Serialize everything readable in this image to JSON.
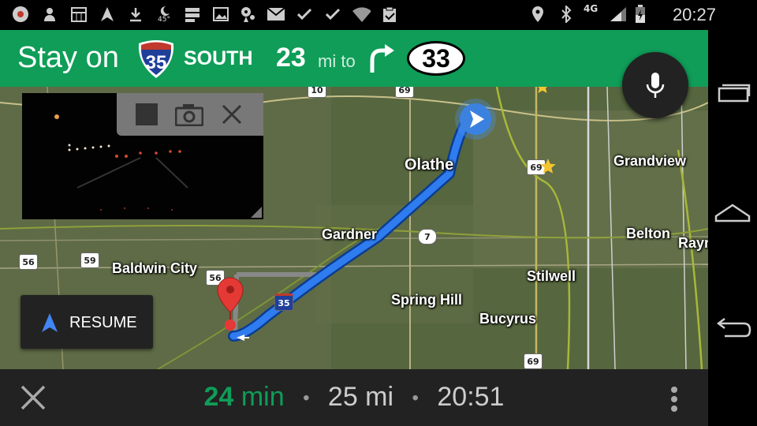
{
  "status_bar": {
    "time": "20:27",
    "network": "4G",
    "weather_temp": "45°"
  },
  "banner": {
    "instruction": "Stay on",
    "highway_number": "35",
    "direction": "SOUTH",
    "distance": "23",
    "distance_unit": "mi to",
    "exit_number": "33",
    "color": "#0f9d58"
  },
  "map": {
    "places": [
      "Olathe",
      "Grandview",
      "Gardner",
      "Belton",
      "Rayr",
      "Baldwin City",
      "Stilwell",
      "Spring Hill",
      "Bucyrus"
    ],
    "route_shields": [
      "10",
      "69",
      "7",
      "56",
      "59",
      "56",
      "35",
      "69"
    ],
    "route_color": "#1a73e8"
  },
  "camera_controls": {
    "stop": "stop-icon",
    "capture": "camera-icon",
    "close": "close-icon"
  },
  "resume_button": {
    "label": "RESUME"
  },
  "trip": {
    "duration_value": "24",
    "duration_unit": "min",
    "distance": "25 mi",
    "arrival": "20:51",
    "separator": "•"
  }
}
